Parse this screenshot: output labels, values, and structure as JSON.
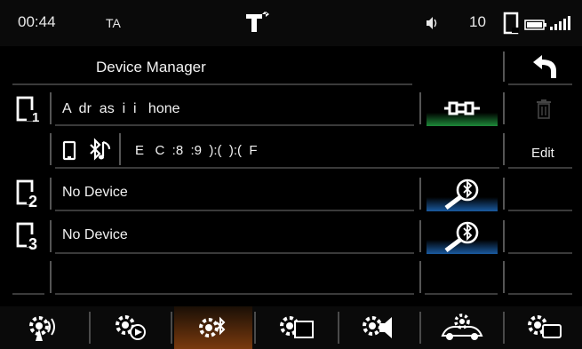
{
  "status": {
    "clock": "00:44",
    "ta": "TA",
    "volume": "10",
    "icons": [
      "tp-icon",
      "speaker-icon",
      "phone-icon",
      "battery-icon",
      "signal-icon"
    ]
  },
  "header": {
    "title": "Device Manager",
    "back_icon": "back-arrow-icon"
  },
  "devices": [
    {
      "slot": "1",
      "name": "A  dr  as  i  i   hone",
      "sub_address": "E   C  :8  :9  ):(  ):(  F",
      "action_icon": "connected-plug-icon",
      "edit_label": "Edit"
    },
    {
      "slot": "2",
      "name": "No Device",
      "action_icon": "bluetooth-search-icon"
    },
    {
      "slot": "3",
      "name": "No Device",
      "action_icon": "bluetooth-search-icon"
    }
  ],
  "bottom_bar": {
    "items": [
      {
        "icon": "gear-antenna-icon"
      },
      {
        "icon": "gear-play-icon"
      },
      {
        "icon": "gear-bluetooth-icon",
        "active": true
      },
      {
        "icon": "gear-screen-icon"
      },
      {
        "icon": "gear-speaker-icon"
      },
      {
        "icon": "gear-car-icon"
      },
      {
        "icon": "gear-device-icon"
      }
    ]
  },
  "colors": {
    "active_tab": "#7a3a0e",
    "connected_green": "#1e8a3a",
    "bluetooth_blue": "#1a5aa0"
  }
}
